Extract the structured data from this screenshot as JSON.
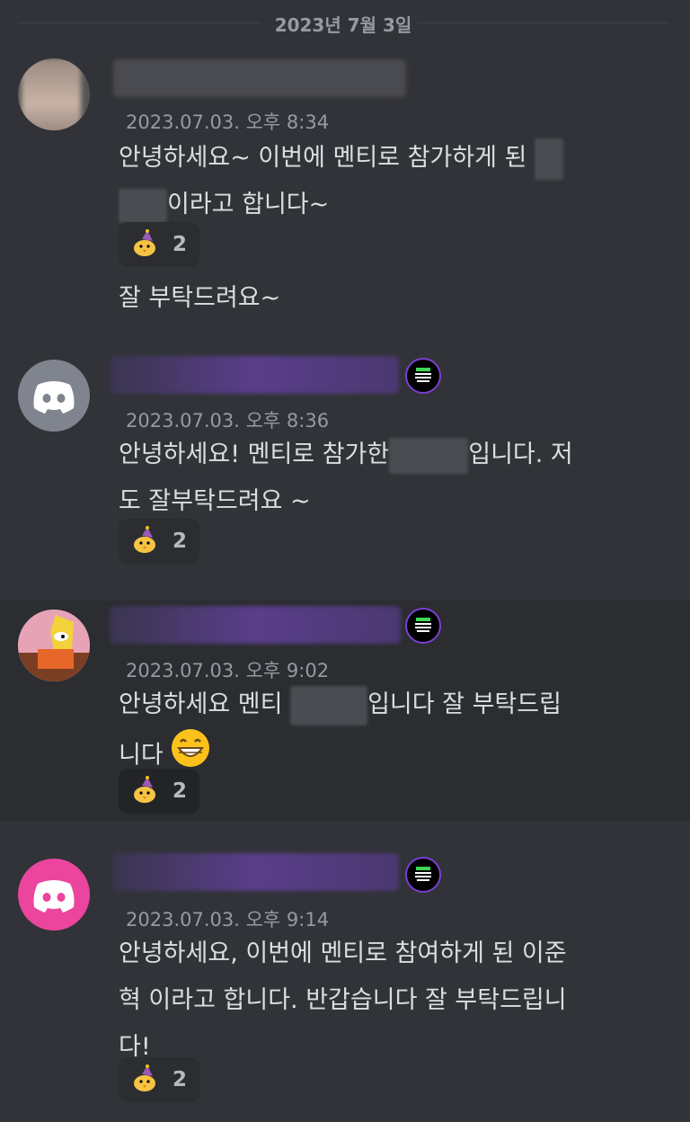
{
  "date_divider": "2023년 7월 3일",
  "messages": [
    {
      "timestamp": "2023.07.03. 오후 8:34",
      "line1_a": "안녕하세요~ 이번에 멘티로 참가하게 된",
      "line2_b": "이라고 합니다~",
      "reaction_count": "2",
      "followup": "잘 부탁드려요~"
    },
    {
      "timestamp": "2023.07.03. 오후 8:36",
      "line1_a": "안녕하세요! 멘티로 참가한",
      "line1_b": "입니다. 저",
      "line2": "도 잘부탁드려요 ~",
      "reaction_count": "2"
    },
    {
      "timestamp": "2023.07.03. 오후 9:02",
      "line1_a": "안녕하세요 멘티",
      "line1_b": "입니다 잘 부탁드립",
      "line2": "니다",
      "reaction_count": "2"
    },
    {
      "timestamp": "2023.07.03. 오후 9:14",
      "line1": "안녕하세요, 이번에 멘티로 참여하게 된 이준",
      "line2": "혁 이라고 합니다. 반갑습니다 잘 부탁드립니",
      "line3": "다!",
      "reaction_count": "2"
    }
  ],
  "colors": {
    "background": "#313338",
    "highlight": "#2b2d31",
    "discord_gray": "#80848e",
    "discord_pink": "#eb459e",
    "timestamp": "#949ba4"
  },
  "icons": {
    "reaction": "party-chick-icon",
    "smile": "grinning-face-icon",
    "avatar_default": "discord-logo-icon"
  }
}
